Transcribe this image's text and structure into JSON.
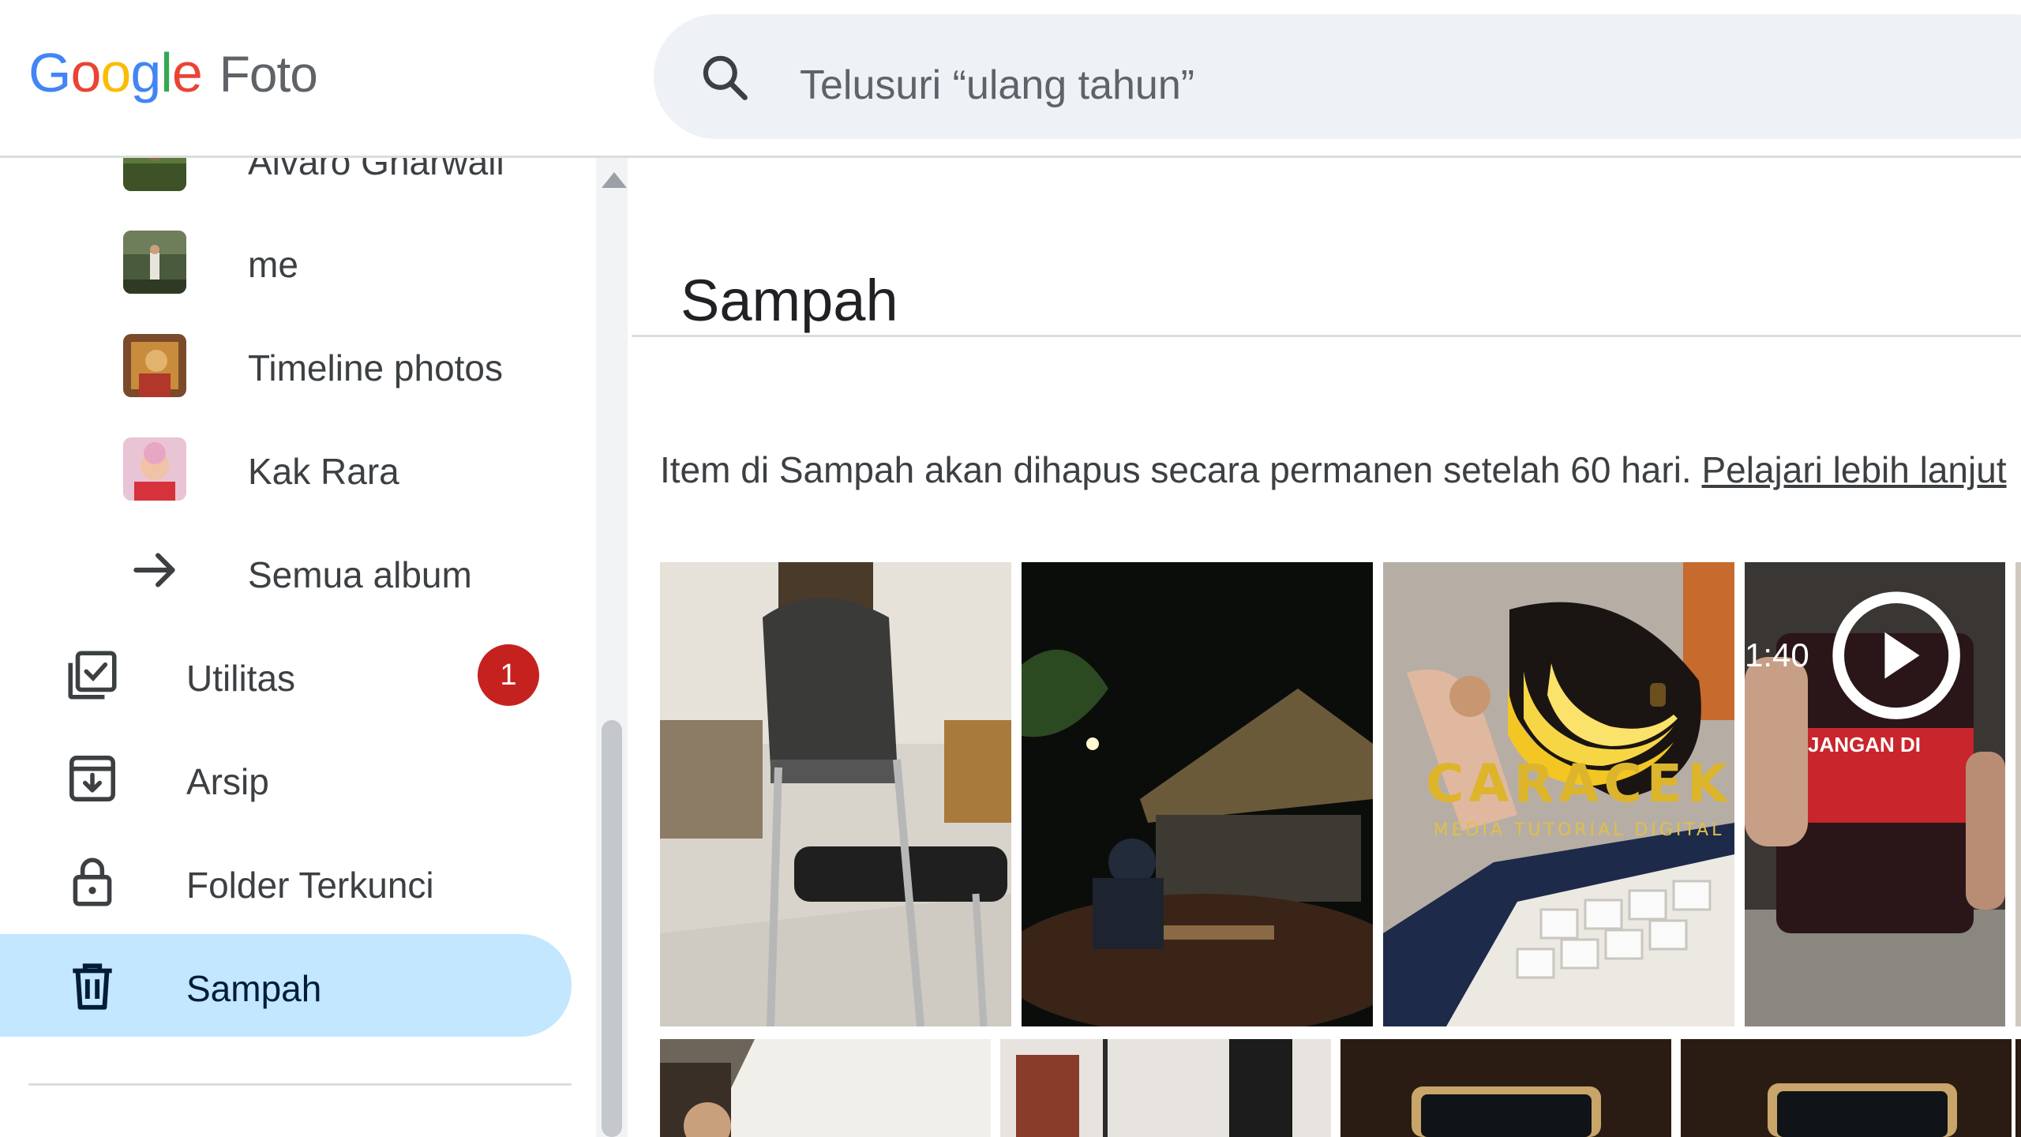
{
  "header": {
    "logo_google": "Google",
    "logo_product": "Foto",
    "search_placeholder": "Telusuri “ulang tahun”"
  },
  "sidebar": {
    "partial_album_label": "Alvaro Gharwali",
    "albums": [
      {
        "label": "me"
      },
      {
        "label": "Timeline photos"
      },
      {
        "label": "Kak Rara"
      }
    ],
    "all_albums_label": "Semua album",
    "nav": [
      {
        "label": "Utilitas",
        "icon": "utilities-icon",
        "badge": "1"
      },
      {
        "label": "Arsip",
        "icon": "archive-icon"
      },
      {
        "label": "Folder Terkunci",
        "icon": "lock-icon"
      },
      {
        "label": "Sampah",
        "icon": "trash-icon",
        "active": true
      }
    ]
  },
  "main": {
    "title": "Sampah",
    "info_text": "Item di Sampah akan dihapus secara permanen setelah 60 hari.",
    "learn_more": "Pelajari lebih lanjut",
    "video_duration": "1:40"
  },
  "watermark": {
    "brand": "CARACEK",
    "tagline": "MEDIA TUTORIAL DIGITAL"
  },
  "colors": {
    "active_nav_bg": "#c2e7ff",
    "badge": "#c5221f",
    "search_bg": "#eef1f6"
  }
}
